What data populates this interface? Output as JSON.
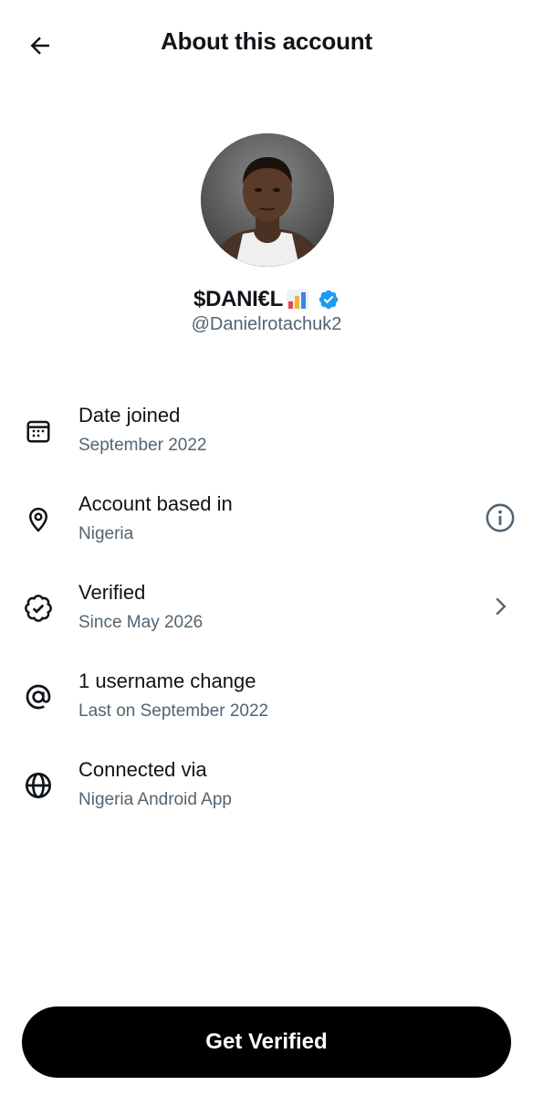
{
  "header": {
    "title": "About this account",
    "back_icon": "arrow-left-icon"
  },
  "profile": {
    "display_name": "$DANI€L",
    "name_emoji": "bar-chart-emoji",
    "verified_badge_color": "#1d9bf0",
    "handle": "@Danielrotachuk2"
  },
  "info": [
    {
      "icon": "calendar-icon",
      "title": "Date joined",
      "subtitle": "September 2022"
    },
    {
      "icon": "location-pin-icon",
      "title": "Account based in",
      "subtitle": "Nigeria",
      "trailing_icon": "info-circle-icon"
    },
    {
      "icon": "verified-badge-outline-icon",
      "title": "Verified",
      "subtitle": "Since May 2026",
      "trailing_icon": "chevron-right-icon"
    },
    {
      "icon": "at-sign-icon",
      "title": "1 username change",
      "subtitle": "Last on September 2022"
    },
    {
      "icon": "globe-icon",
      "title": "Connected via",
      "subtitle": "Nigeria Android App"
    }
  ],
  "cta": {
    "label": "Get Verified",
    "background": "#000000",
    "text_color": "#ffffff"
  }
}
